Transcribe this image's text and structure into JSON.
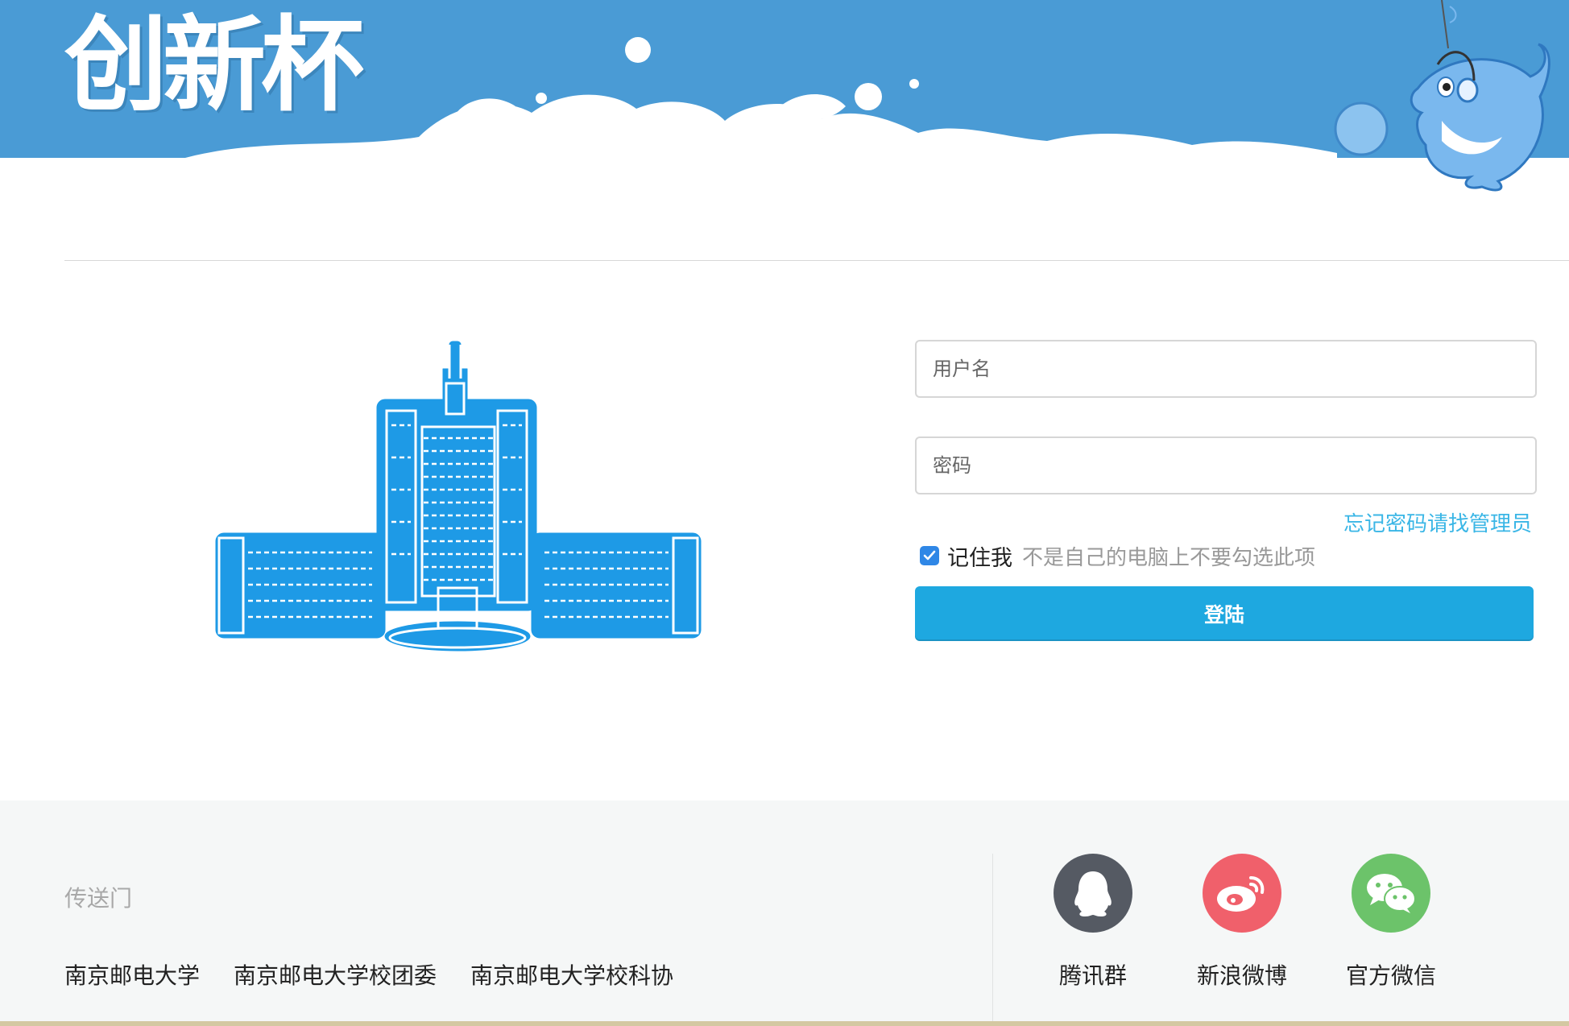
{
  "header": {
    "brand_title": "创新杯"
  },
  "login": {
    "username_placeholder": "用户名",
    "password_placeholder": "密码",
    "forgot_password": "忘记密码请找管理员",
    "remember_me_label": "记住我",
    "remember_me_checked": true,
    "remember_me_hint": "不是自己的电脑上不要勾选此项",
    "submit_label": "登陆"
  },
  "footer": {
    "portal_title": "传送门",
    "portal_links": [
      "南京邮电大学",
      "南京邮电大学校团委",
      "南京邮电大学校科协"
    ],
    "social": [
      {
        "label": "腾讯群",
        "icon": "qq-icon",
        "color": "#555a63"
      },
      {
        "label": "新浪微博",
        "icon": "weibo-icon",
        "color": "#f0606b"
      },
      {
        "label": "官方微信",
        "icon": "wechat-icon",
        "color": "#6cc36a"
      }
    ]
  },
  "colors": {
    "banner_blue": "#4a9bd5",
    "accent_blue": "#1ea8e0",
    "link_blue": "#3ab6e6",
    "building_blue": "#1e9ae6",
    "footer_bg": "#f5f7f7"
  }
}
